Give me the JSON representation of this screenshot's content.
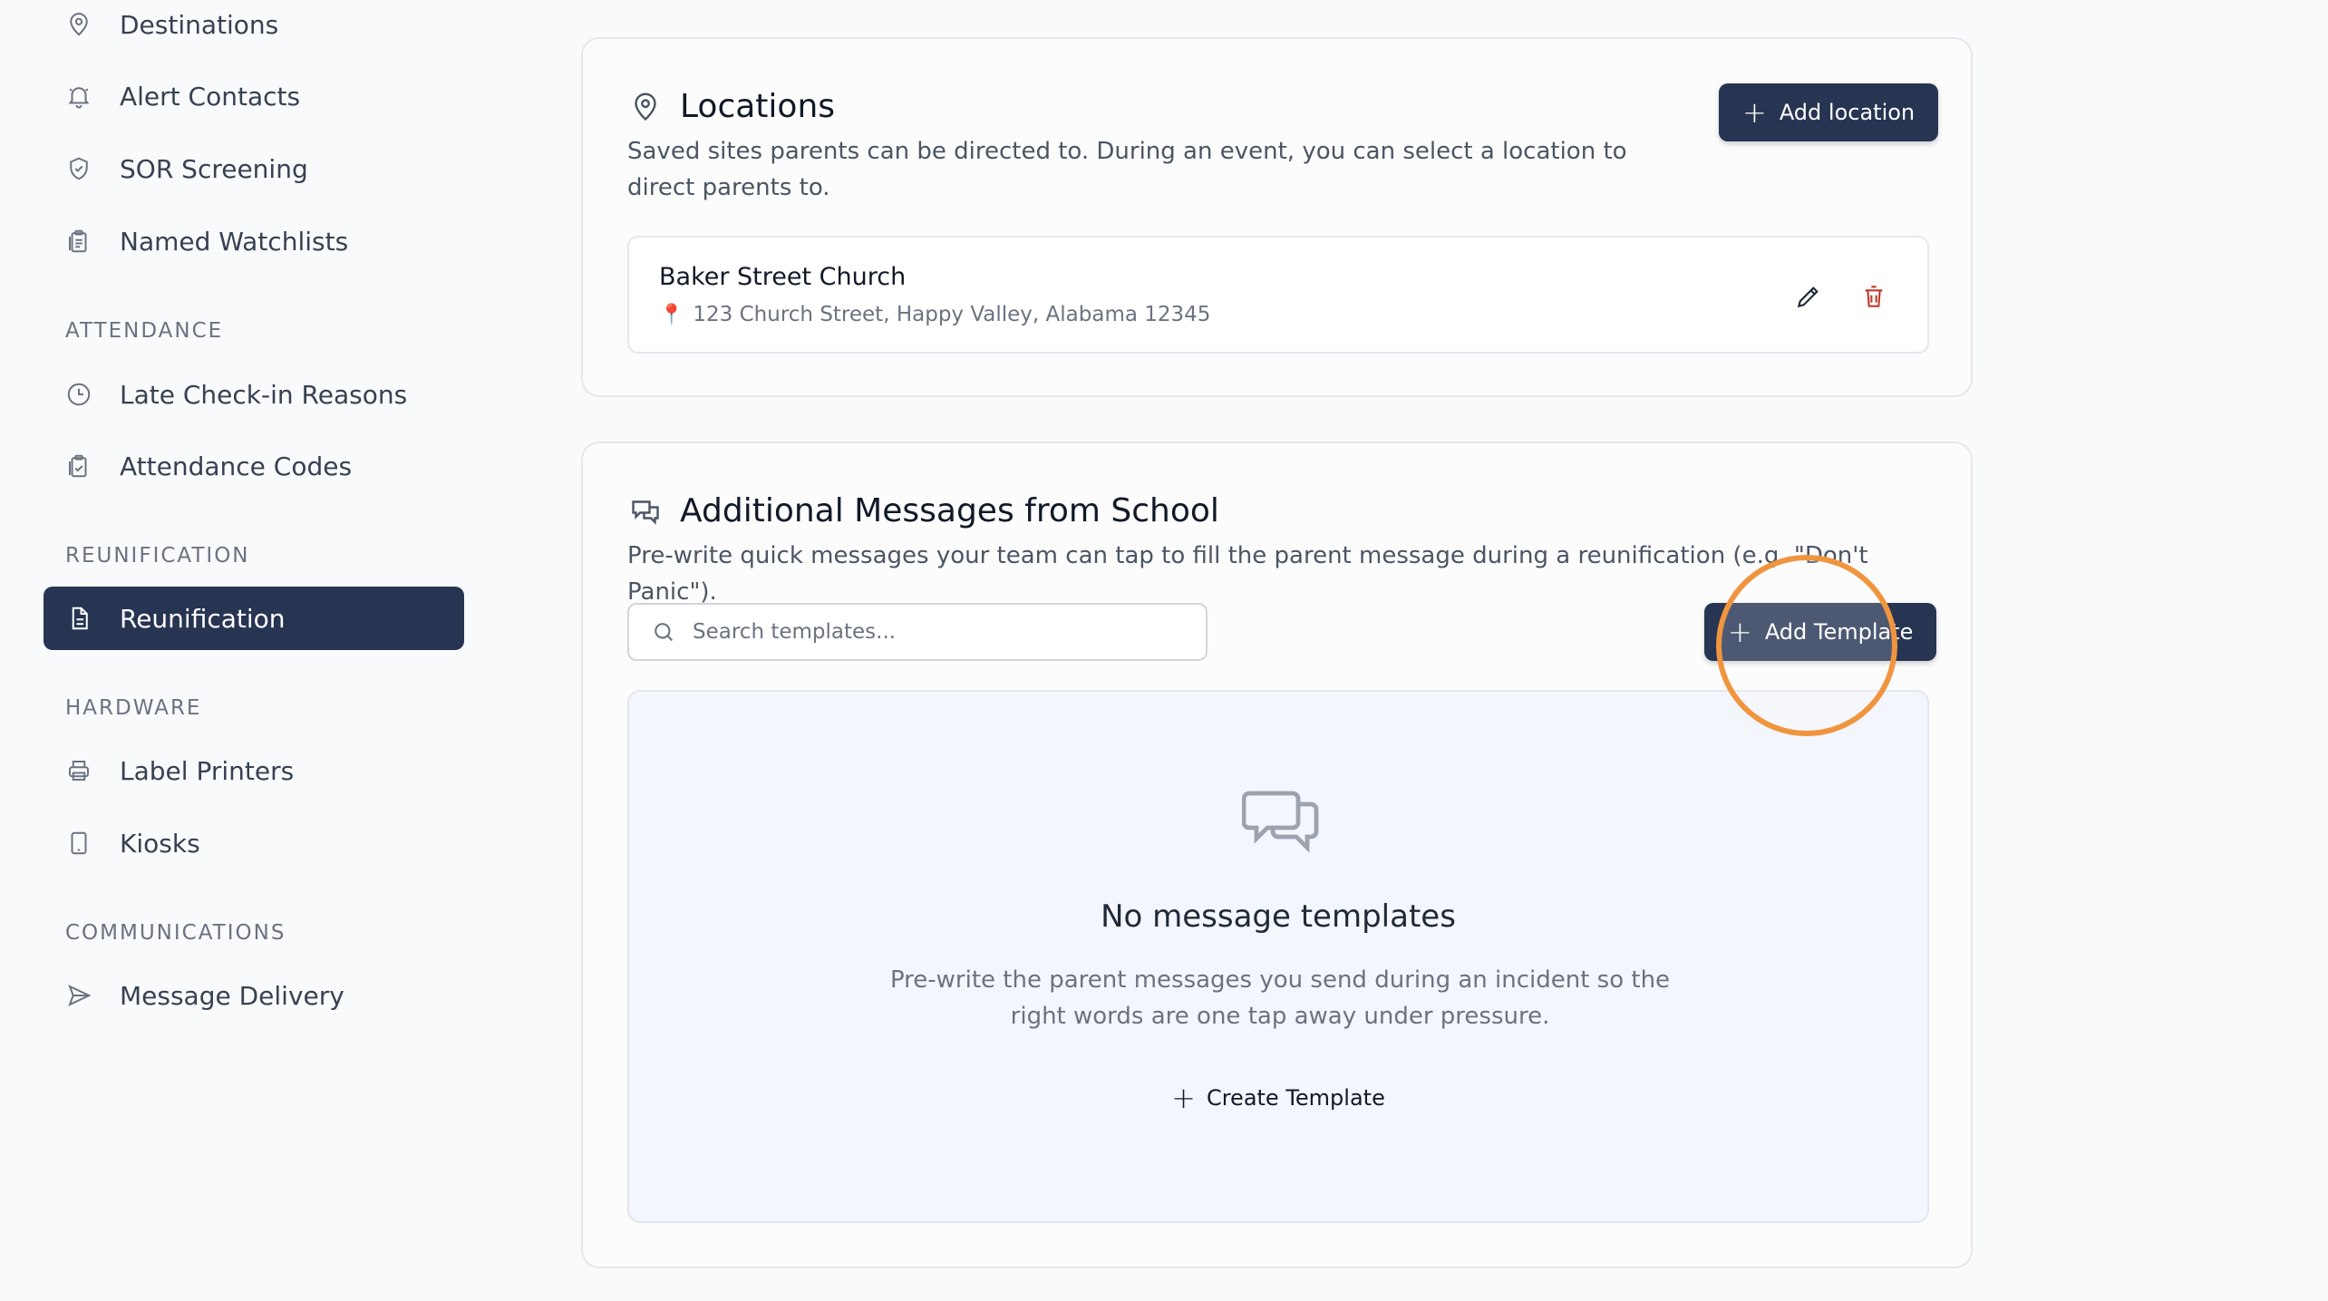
{
  "sidebar": {
    "items": [
      {
        "label": "Destinations",
        "icon": "map-pin-icon"
      },
      {
        "label": "Alert Contacts",
        "icon": "bell-icon"
      },
      {
        "label": "SOR Screening",
        "icon": "shield-check-icon"
      },
      {
        "label": "Named Watchlists",
        "icon": "clipboard-list-icon"
      },
      {
        "label": "Late Check-in Reasons",
        "icon": "clock-icon"
      },
      {
        "label": "Attendance Codes",
        "icon": "clipboard-check-icon"
      },
      {
        "label": "Reunification",
        "icon": "document-icon"
      },
      {
        "label": "Label Printers",
        "icon": "printer-icon"
      },
      {
        "label": "Kiosks",
        "icon": "tablet-icon"
      },
      {
        "label": "Message Delivery",
        "icon": "send-icon"
      }
    ],
    "sections": {
      "attendance": "ATTENDANCE",
      "reunification": "REUNIFICATION",
      "hardware": "HARDWARE",
      "communications": "COMMUNICATIONS"
    },
    "active_item": "Reunification"
  },
  "locations": {
    "title": "Locations",
    "description": "Saved sites parents can be directed to. During an event, you can select a location to direct parents to.",
    "add_button": "Add location",
    "items": [
      {
        "name": "Baker Street Church",
        "address": "123 Church Street, Happy Valley, Alabama 12345"
      }
    ]
  },
  "messages": {
    "title": "Additional Messages from School",
    "description": "Pre-write quick messages your team can tap to fill the parent message during a reunification (e.g. \"Don't Panic\").",
    "search_placeholder": "Search templates...",
    "add_button": "Add Template",
    "empty_title": "No message templates",
    "empty_description": "Pre-write the parent messages you send during an incident so the right words are one tap away under pressure.",
    "create_link": "Create Template"
  },
  "colors": {
    "sidebar_active": "#273553",
    "primary_button": "#273553",
    "highlight_ring": "#f0953e",
    "delete_icon": "#c0392b"
  }
}
